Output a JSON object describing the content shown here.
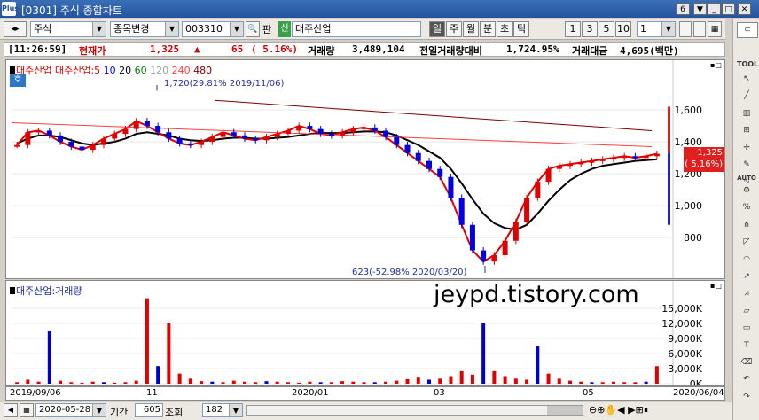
{
  "window": {
    "title": "[0301] 주식 종합차트",
    "logo": "Plus",
    "page_indicator": "6",
    "title_buttons": [
      "▼",
      "_",
      "□",
      "✕"
    ]
  },
  "toolbar": {
    "market_select": "주식",
    "mode_select": "종목변경",
    "code_value": "003310",
    "pan_label": "판",
    "sin_badge": "신",
    "stock_name": "대주산업",
    "periods": [
      "일",
      "주",
      "월",
      "분",
      "초",
      "틱"
    ],
    "active_period": "일",
    "interval_buttons": [
      "1",
      "3",
      "5",
      "10"
    ],
    "interval_value": "1"
  },
  "infobar": {
    "time": "[11:26:59]",
    "price_label": "현재가",
    "price": "1,325",
    "change_arrow": "▲",
    "change": "65",
    "change_pct": "( 5.16%)",
    "volume_label": "거래량",
    "volume": "3,489,104",
    "prev_ratio_label": "전일거래량대비",
    "prev_ratio": "1,724.95%",
    "amount_label": "거래대금",
    "amount": "4,695(백만)"
  },
  "price_panel": {
    "legend": [
      "대주산업",
      "대주산업:5",
      "10",
      "20",
      "60",
      "120",
      "240",
      "480"
    ],
    "legend_colors": [
      "#e00000",
      "#e00000",
      "#0000ff",
      "#000000",
      "#008000",
      "#a0a0a0",
      "#ff4040",
      "#800000"
    ],
    "hoga_label": "호",
    "high_annotation": "1,720(29.81% 2019/11/06)",
    "low_annotation": "623(-52.98% 2020/03/20)",
    "current_price_box": "1,325",
    "current_pct_box": "( 5.16%)"
  },
  "volume_panel": {
    "legend": "대주산업:거래량",
    "watermark": "jeypd.tistory.com"
  },
  "x_axis": {
    "ticks": [
      "2019/09/06",
      "11",
      "2020/01",
      "03",
      "05"
    ],
    "end_date": "2020/06/04"
  },
  "bottom": {
    "date_value": "2020-05-28",
    "period_label": "기간",
    "period_value": "605",
    "query_label": "조회",
    "count_value": "182"
  },
  "sidebar": {
    "tool_label": "TOOL",
    "auto_label": "AUTO",
    "icons": [
      "cursor-icon",
      "line-icon",
      "bar-icon",
      "grid-icon",
      "crosshair-icon",
      "pencil-icon",
      "wave-icon",
      "auto-icon",
      "percent-icon",
      "fork-icon",
      "fan-icon",
      "arc-icon",
      "trend-icon",
      "zigzag-icon",
      "channel-icon",
      "box-icon",
      "text-icon",
      "eraser-icon",
      "undo-icon",
      "redo-icon"
    ]
  },
  "chart_data": [
    {
      "type": "candlestick",
      "title": "",
      "y_ticks": [
        800,
        1000,
        1200,
        1400,
        1600
      ],
      "ylim": [
        590,
        1800
      ],
      "current_price": 1325,
      "high_point": {
        "date": "2019/11/06",
        "value": 1720
      },
      "low_point": {
        "date": "2020/03/20",
        "value": 623
      },
      "moving_averages": [
        "5",
        "10",
        "20",
        "60",
        "120",
        "240",
        "480"
      ],
      "series": [
        {
          "name": "대주산업",
          "values": [
            1380,
            1460,
            1470,
            1440,
            1400,
            1370,
            1350,
            1380,
            1420,
            1450,
            1480,
            1530,
            1500,
            1460,
            1420,
            1390,
            1380,
            1400,
            1430,
            1460,
            1440,
            1420,
            1410,
            1430,
            1450,
            1470,
            1500,
            1480,
            1450,
            1440,
            1460,
            1480,
            1490,
            1470,
            1430,
            1380,
            1330,
            1280,
            1230,
            1180,
            1050,
            880,
            720,
            650,
            690,
            780,
            900,
            1050,
            1150,
            1230,
            1250,
            1260,
            1270,
            1280,
            1290,
            1300,
            1310,
            1300,
            1310,
            1325
          ]
        },
        {
          "name": "20",
          "values": [
            1390,
            1420,
            1440,
            1440,
            1430,
            1410,
            1390,
            1380,
            1390,
            1400,
            1420,
            1450,
            1460,
            1450,
            1440,
            1420,
            1410,
            1405,
            1410,
            1420,
            1425,
            1425,
            1420,
            1420,
            1425,
            1430,
            1440,
            1450,
            1455,
            1455,
            1455,
            1460,
            1465,
            1465,
            1460,
            1440,
            1410,
            1380,
            1340,
            1300,
            1230,
            1140,
            1040,
            950,
            890,
            860,
            850,
            880,
            950,
            1030,
            1100,
            1160,
            1200,
            1230,
            1250,
            1260,
            1270,
            1280,
            1285,
            1290
          ]
        }
      ]
    },
    {
      "type": "bar",
      "title": "",
      "y_ticks": [
        "0K",
        "3,000K",
        "6,000K",
        "9,000K",
        "12,000K",
        "15,000K"
      ],
      "ylim": [
        0,
        18000
      ],
      "series": [
        {
          "name": "대주산업:거래량",
          "values": [
            300,
            800,
            400,
            10500,
            600,
            300,
            200,
            400,
            300,
            200,
            300,
            600,
            17000,
            3500,
            12000,
            2000,
            1000,
            500,
            400,
            300,
            600,
            400,
            300,
            500,
            400,
            300,
            200,
            400,
            300,
            300,
            500,
            400,
            300,
            300,
            400,
            600,
            900,
            1200,
            800,
            1000,
            1500,
            2500,
            1800,
            12000,
            2500,
            1500,
            1000,
            800,
            7500,
            2000,
            1000,
            600,
            400,
            300,
            300,
            400,
            300,
            300,
            400,
            3489
          ]
        }
      ]
    }
  ]
}
